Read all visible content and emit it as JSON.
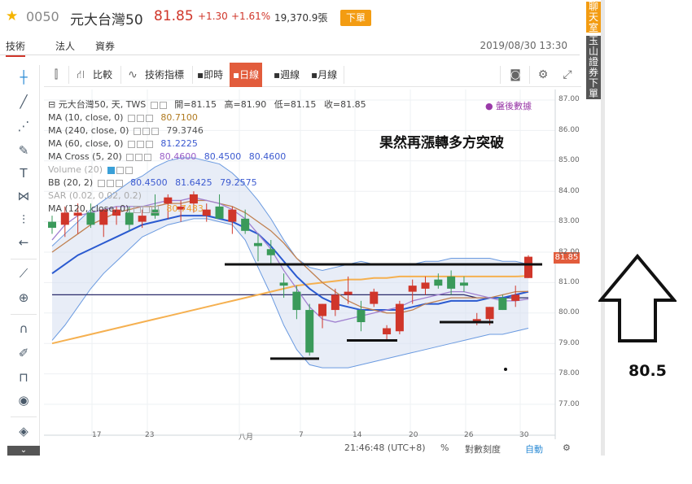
{
  "header": {
    "code": "0050",
    "name": "元大台灣50",
    "price": "81.85",
    "change": "+1.30",
    "change_pct": "+1.61%",
    "volume": "19,370.9張",
    "market_status": "下單"
  },
  "tabs": [
    {
      "label": "技術"
    },
    {
      "label": "法人"
    },
    {
      "label": "資券"
    }
  ],
  "datetime": "2019/08/30 13:30",
  "side_tabs": {
    "chat": "聊天室",
    "broker": "玉山證券下單"
  },
  "toolbar": {
    "compare": "比較",
    "indicators": "技術指標",
    "intraday": "即時",
    "daily": "日線",
    "weekly": "週線",
    "monthly": "月線"
  },
  "legend": {
    "symbol_line": "元大台灣50, 天, TWS",
    "open": "開=81.15",
    "high": "高=81.90",
    "low": "低=81.15",
    "close": "收=81.85",
    "after_hours": "盤後數據",
    "ma10": {
      "label": "MA (10, close, 0)",
      "value": "80.7100"
    },
    "ma240": {
      "label": "MA (240, close, 0)",
      "value": "79.3746"
    },
    "ma60": {
      "label": "MA (60, close, 0)",
      "value": "81.2225"
    },
    "macross": {
      "label": "MA Cross (5, 20)",
      "values": [
        "80.4600",
        "80.4500",
        "80.4600"
      ]
    },
    "volume": {
      "label": "Volume (20)"
    },
    "bb": {
      "label": "BB (20, 2)",
      "values": [
        "80.4500",
        "81.6425",
        "79.2575"
      ]
    },
    "sar": {
      "label": "SAR (0.02, 0.02, 0.2)"
    },
    "ma120": {
      "label": "MA (120, close, 0)",
      "value": "80.7483"
    }
  },
  "annotation": "果然再漲轉多方突破",
  "price_tag": "81.85",
  "y_axis": [
    "87.00",
    "86.00",
    "85.00",
    "84.00",
    "83.00",
    "82.00",
    "81.00",
    "80.00",
    "79.00",
    "78.00",
    "77.00"
  ],
  "x_axis": [
    "17",
    "23",
    "八月",
    "7",
    "14",
    "20",
    "26",
    "30"
  ],
  "status": {
    "time": "21:46:48 (UTC+8)",
    "percent": "%",
    "log": "對數刻度",
    "auto": "自動"
  },
  "big_arrow_label": "80.5",
  "colors": {
    "up": "#d0362a",
    "down": "#3a9a5a",
    "accent": "#f39c12",
    "active": "#e25c3c"
  },
  "chart_data": {
    "type": "candlestick",
    "ylim": [
      76.6,
      87.1
    ],
    "candles": [
      {
        "o": 83.0,
        "h": 83.2,
        "l": 82.6,
        "c": 82.8
      },
      {
        "o": 82.9,
        "h": 83.5,
        "l": 82.5,
        "c": 83.3
      },
      {
        "o": 83.2,
        "h": 83.6,
        "l": 82.6,
        "c": 83.3
      },
      {
        "o": 83.3,
        "h": 83.6,
        "l": 82.8,
        "c": 82.9
      },
      {
        "o": 82.9,
        "h": 83.3,
        "l": 82.5,
        "c": 83.4
      },
      {
        "o": 83.2,
        "h": 83.5,
        "l": 82.9,
        "c": 83.4
      },
      {
        "o": 83.3,
        "h": 83.5,
        "l": 82.7,
        "c": 82.9
      },
      {
        "o": 83.0,
        "h": 83.4,
        "l": 82.8,
        "c": 83.2
      },
      {
        "o": 83.4,
        "h": 83.9,
        "l": 83.1,
        "c": 83.2
      },
      {
        "o": 83.6,
        "h": 83.9,
        "l": 83.1,
        "c": 83.8
      },
      {
        "o": 83.4,
        "h": 83.7,
        "l": 83.0,
        "c": 83.5
      },
      {
        "o": 83.6,
        "h": 84.0,
        "l": 83.3,
        "c": 83.9
      },
      {
        "o": 83.2,
        "h": 83.6,
        "l": 83.0,
        "c": 83.4
      },
      {
        "o": 83.5,
        "h": 83.9,
        "l": 83.2,
        "c": 83.1
      },
      {
        "o": 83.0,
        "h": 83.5,
        "l": 82.6,
        "c": 83.4
      },
      {
        "o": 83.1,
        "h": 83.4,
        "l": 82.6,
        "c": 82.7
      },
      {
        "o": 82.3,
        "h": 82.6,
        "l": 81.7,
        "c": 82.2
      },
      {
        "o": 82.1,
        "h": 82.4,
        "l": 81.6,
        "c": 81.9
      },
      {
        "o": 81.0,
        "h": 81.3,
        "l": 80.5,
        "c": 80.9
      },
      {
        "o": 80.7,
        "h": 80.9,
        "l": 79.8,
        "c": 80.1
      },
      {
        "o": 80.1,
        "h": 80.3,
        "l": 78.6,
        "c": 78.7
      },
      {
        "o": 79.9,
        "h": 80.3,
        "l": 79.5,
        "c": 80.3
      },
      {
        "o": 80.1,
        "h": 80.8,
        "l": 79.9,
        "c": 80.6
      },
      {
        "o": 80.6,
        "h": 81.2,
        "l": 80.3,
        "c": 80.7
      },
      {
        "o": 80.1,
        "h": 80.4,
        "l": 79.4,
        "c": 79.7
      },
      {
        "o": 80.3,
        "h": 80.8,
        "l": 80.2,
        "c": 80.7
      },
      {
        "o": 79.3,
        "h": 79.6,
        "l": 79.1,
        "c": 79.5
      },
      {
        "o": 79.4,
        "h": 80.4,
        "l": 79.3,
        "c": 80.3
      },
      {
        "o": 80.7,
        "h": 81.1,
        "l": 80.3,
        "c": 80.9
      },
      {
        "o": 80.8,
        "h": 81.2,
        "l": 80.6,
        "c": 81.0
      },
      {
        "o": 81.1,
        "h": 81.3,
        "l": 80.8,
        "c": 80.9
      },
      {
        "o": 81.2,
        "h": 81.4,
        "l": 80.6,
        "c": 80.8
      },
      {
        "o": 81.0,
        "h": 81.2,
        "l": 80.7,
        "c": 80.9
      },
      {
        "o": 79.7,
        "h": 80.0,
        "l": 79.6,
        "c": 79.8
      },
      {
        "o": 79.8,
        "h": 80.2,
        "l": 79.6,
        "c": 80.2
      },
      {
        "o": 80.5,
        "h": 80.6,
        "l": 80.1,
        "c": 80.1
      },
      {
        "o": 80.4,
        "h": 80.9,
        "l": 80.2,
        "c": 80.6
      },
      {
        "o": 81.15,
        "h": 81.9,
        "l": 81.15,
        "c": 81.85
      }
    ],
    "bb_upper": [
      82.2,
      82.6,
      83.0,
      83.4,
      83.7,
      84.0,
      84.3,
      84.5,
      84.8,
      85.0,
      85.1,
      85.1,
      85.0,
      84.9,
      84.6,
      84.2,
      83.7,
      83.1,
      82.4,
      81.8,
      81.5,
      81.4,
      81.5,
      81.6,
      81.7,
      81.6,
      81.6,
      81.6,
      81.6,
      81.7,
      81.7,
      81.8,
      81.8,
      81.8,
      81.8,
      81.7,
      81.7,
      81.6
    ],
    "bb_lower": [
      79.1,
      79.6,
      80.2,
      80.8,
      81.3,
      81.7,
      82.1,
      82.5,
      82.7,
      82.9,
      83.0,
      83.1,
      83.1,
      83.0,
      82.9,
      82.4,
      81.5,
      80.6,
      79.6,
      78.8,
      78.3,
      78.2,
      78.2,
      78.2,
      78.3,
      78.4,
      78.5,
      78.6,
      78.7,
      78.8,
      78.9,
      79.0,
      79.1,
      79.2,
      79.3,
      79.3,
      79.4,
      79.5
    ],
    "ma240": [
      80.6,
      80.6,
      80.6,
      80.6,
      80.6,
      80.6,
      80.6,
      80.6,
      80.6,
      80.6,
      80.6,
      80.6,
      80.6,
      80.6,
      80.6,
      80.6,
      80.6,
      80.6,
      80.6,
      80.6,
      80.6,
      80.6,
      80.6,
      80.6,
      80.6,
      80.6,
      80.6,
      80.6,
      80.6,
      80.6,
      80.6,
      80.6,
      80.6,
      80.5,
      80.5,
      80.5,
      80.5,
      80.5
    ],
    "ma60": [
      79.0,
      79.1,
      79.2,
      79.3,
      79.4,
      79.5,
      79.6,
      79.7,
      79.8,
      79.9,
      80.0,
      80.1,
      80.2,
      80.3,
      80.4,
      80.5,
      80.6,
      80.7,
      80.8,
      80.9,
      80.95,
      81.0,
      81.05,
      81.1,
      81.1,
      81.15,
      81.15,
      81.2,
      81.2,
      81.2,
      81.2,
      81.2,
      81.2,
      81.2,
      81.2,
      81.2,
      81.2,
      81.22
    ],
    "ma120": [
      81.3,
      81.6,
      81.9,
      82.1,
      82.3,
      82.5,
      82.7,
      82.9,
      83.0,
      83.1,
      83.2,
      83.2,
      83.2,
      83.1,
      83.0,
      82.8,
      82.6,
      82.2,
      81.7,
      81.2,
      80.8,
      80.5,
      80.3,
      80.2,
      80.1,
      80.1,
      80.1,
      80.1,
      80.2,
      80.3,
      80.3,
      80.4,
      80.4,
      80.4,
      80.5,
      80.5,
      80.6,
      80.7
    ],
    "ma10": [
      82.0,
      82.3,
      82.6,
      82.9,
      83.1,
      83.3,
      83.4,
      83.5,
      83.5,
      83.6,
      83.6,
      83.7,
      83.7,
      83.6,
      83.5,
      83.3,
      83.0,
      82.7,
      82.3,
      81.8,
      81.4,
      81.0,
      80.7,
      80.4,
      80.2,
      80.1,
      80.0,
      80.0,
      80.1,
      80.3,
      80.4,
      80.5,
      80.5,
      80.5,
      80.5,
      80.6,
      80.7,
      80.71
    ],
    "ma5": [
      82.4,
      82.9,
      83.2,
      83.3,
      83.4,
      83.5,
      83.5,
      83.5,
      83.6,
      83.7,
      83.7,
      83.8,
      83.7,
      83.6,
      83.4,
      83.1,
      82.6,
      82.1,
      81.4,
      80.8,
      80.2,
      79.8,
      79.7,
      79.8,
      79.9,
      80.0,
      80.1,
      80.2,
      80.4,
      80.5,
      80.6,
      80.7,
      80.7,
      80.6,
      80.5,
      80.4,
      80.4,
      80.46
    ],
    "support_lines": [
      78.5,
      79.1,
      79.7
    ],
    "resistance_line": 81.6
  }
}
